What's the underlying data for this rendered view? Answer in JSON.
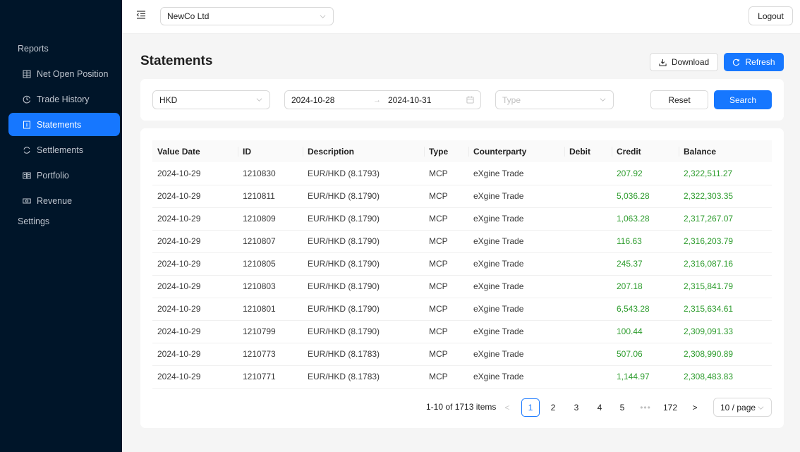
{
  "sidebar": {
    "groups": [
      {
        "label": "Reports"
      },
      {
        "label": "Settings"
      }
    ],
    "items": [
      {
        "label": "Net Open Position",
        "icon": "table-icon",
        "active": false
      },
      {
        "label": "Trade History",
        "icon": "history-icon",
        "active": false
      },
      {
        "label": "Statements",
        "icon": "file-icon",
        "active": true
      },
      {
        "label": "Settlements",
        "icon": "sync-icon",
        "active": false
      },
      {
        "label": "Portfolio",
        "icon": "book-icon",
        "active": false
      },
      {
        "label": "Revenue",
        "icon": "money-icon",
        "active": false
      }
    ]
  },
  "header": {
    "company": "NewCo Ltd",
    "logout_label": "Logout"
  },
  "page": {
    "title": "Statements",
    "download_label": "Download",
    "refresh_label": "Refresh"
  },
  "filters": {
    "currency": "HKD",
    "date_from": "2024-10-28",
    "date_to": "2024-10-31",
    "range_separator": "→",
    "type_placeholder": "Type",
    "reset_label": "Reset",
    "search_label": "Search"
  },
  "table": {
    "columns": [
      "Value Date",
      "ID",
      "Description",
      "Type",
      "Counterparty",
      "Debit",
      "Credit",
      "Balance"
    ],
    "rows": [
      [
        "2024-10-29",
        "1210830",
        "EUR/HKD (8.1793)",
        "MCP",
        "eXgine Trade",
        "",
        "207.92",
        "2,322,511.27"
      ],
      [
        "2024-10-29",
        "1210811",
        "EUR/HKD (8.1790)",
        "MCP",
        "eXgine Trade",
        "",
        "5,036.28",
        "2,322,303.35"
      ],
      [
        "2024-10-29",
        "1210809",
        "EUR/HKD (8.1790)",
        "MCP",
        "eXgine Trade",
        "",
        "1,063.28",
        "2,317,267.07"
      ],
      [
        "2024-10-29",
        "1210807",
        "EUR/HKD (8.1790)",
        "MCP",
        "eXgine Trade",
        "",
        "116.63",
        "2,316,203.79"
      ],
      [
        "2024-10-29",
        "1210805",
        "EUR/HKD (8.1790)",
        "MCP",
        "eXgine Trade",
        "",
        "245.37",
        "2,316,087.16"
      ],
      [
        "2024-10-29",
        "1210803",
        "EUR/HKD (8.1790)",
        "MCP",
        "eXgine Trade",
        "",
        "207.18",
        "2,315,841.79"
      ],
      [
        "2024-10-29",
        "1210801",
        "EUR/HKD (8.1790)",
        "MCP",
        "eXgine Trade",
        "",
        "6,543.28",
        "2,315,634.61"
      ],
      [
        "2024-10-29",
        "1210799",
        "EUR/HKD (8.1790)",
        "MCP",
        "eXgine Trade",
        "",
        "100.44",
        "2,309,091.33"
      ],
      [
        "2024-10-29",
        "1210773",
        "EUR/HKD (8.1783)",
        "MCP",
        "eXgine Trade",
        "",
        "507.06",
        "2,308,990.89"
      ],
      [
        "2024-10-29",
        "1210771",
        "EUR/HKD (8.1783)",
        "MCP",
        "eXgine Trade",
        "",
        "1,144.97",
        "2,308,483.83"
      ]
    ]
  },
  "pagination": {
    "total_text": "1-10 of 1713 items",
    "prev": "<",
    "next": ">",
    "pages": [
      "1",
      "2",
      "3",
      "4",
      "5"
    ],
    "ellipsis": "•••",
    "last_page": "172",
    "current": "1",
    "page_size": "10 / page"
  },
  "colors": {
    "sidebar_bg": "#001529",
    "accent": "#1677ff",
    "positive": "#2e9d2e"
  }
}
